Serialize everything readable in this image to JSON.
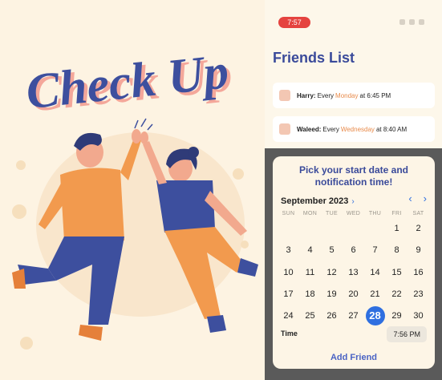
{
  "hero": {
    "title": "Check Up"
  },
  "status_bar": {
    "time": "7:57"
  },
  "friends_list": {
    "title": "Friends List",
    "items": [
      {
        "name": "Harry:",
        "every": "Every",
        "day": "Monday",
        "time": "at 6:45 PM"
      },
      {
        "name": "Waleed:",
        "every": "Every",
        "day": "Wednesday",
        "time": "at 8:40 AM"
      }
    ]
  },
  "picker": {
    "prompt_line1": "Pick your start date and",
    "prompt_line2": "notification time!",
    "month": "September 2023",
    "weekdays": [
      "SUN",
      "MON",
      "TUE",
      "WED",
      "THU",
      "FRI",
      "SAT"
    ],
    "days": [
      "1",
      "2",
      "3",
      "4",
      "5",
      "6",
      "7",
      "8",
      "9",
      "10",
      "11",
      "12",
      "13",
      "14",
      "15",
      "16",
      "17",
      "18",
      "19",
      "20",
      "21",
      "22",
      "23",
      "24",
      "25",
      "26",
      "27",
      "28",
      "29",
      "30"
    ],
    "first_weekday_index": 5,
    "selected_day": "28",
    "time_label": "Time",
    "time_value": "7:56 PM",
    "add_button": "Add Friend"
  },
  "colors": {
    "accent": "#2f6fe0",
    "title": "#3a4a9a",
    "day_highlight": "#e88a4a",
    "badge": "#e5433f"
  }
}
